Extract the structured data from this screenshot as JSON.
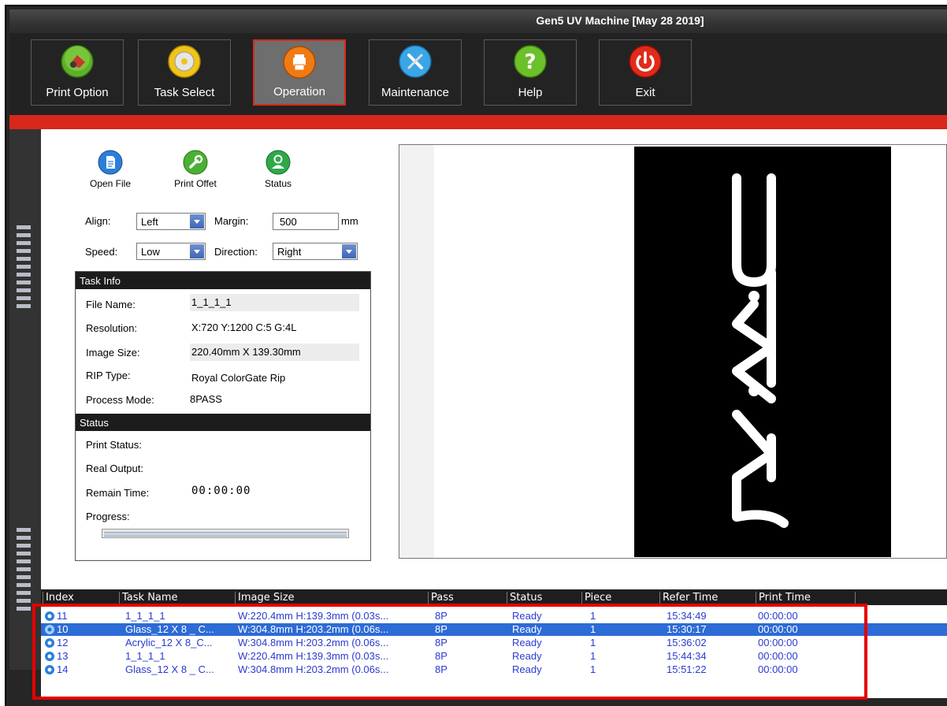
{
  "window": {
    "title": "Gen5 UV Machine [May 28 2019]"
  },
  "toolbar": {
    "buttons": [
      {
        "label": "Print Option",
        "icon": "printer-gear-icon"
      },
      {
        "label": "Task Select",
        "icon": "disc-icon"
      },
      {
        "label": "Operation",
        "icon": "print-icon"
      },
      {
        "label": "Maintenance",
        "icon": "tools-icon"
      },
      {
        "label": "Help",
        "icon": "help-icon"
      },
      {
        "label": "Exit",
        "icon": "power-icon"
      }
    ],
    "active": "Operation"
  },
  "actions": {
    "open_file": "Open File",
    "print_offset": "Print Offet",
    "status": "Status"
  },
  "settings": {
    "align_label": "Align:",
    "align_value": "Left",
    "margin_label": "Margin:",
    "margin_value": "500",
    "margin_unit": "mm",
    "speed_label": "Speed:",
    "speed_value": "Low",
    "direction_label": "Direction:",
    "direction_value": "Right"
  },
  "task_info": {
    "header": "Task Info",
    "file_name_label": "File Name:",
    "file_name": "1_1_1_1",
    "resolution_label": "Resolution:",
    "resolution": "X:720 Y:1200 C:5 G:4L",
    "image_size_label": "Image Size:",
    "image_size": "220.40mm X 139.30mm",
    "rip_type_label": "RIP Type:",
    "rip_type": "Royal ColorGate Rip",
    "process_mode_label": "Process Mode:",
    "process_mode": "8PASS"
  },
  "status": {
    "header": "Status",
    "print_status_label": "Print Status:",
    "real_output_label": "Real Output:",
    "remain_time_label": "Remain Time:",
    "remain_time": "00:00:00",
    "progress_label": "Progress:",
    "progress_fraction": 0.0
  },
  "table": {
    "columns": [
      "Index",
      "Task Name",
      "Image Size",
      "Pass",
      "Status",
      "Piece",
      "Refer Time",
      "Print Time"
    ],
    "rows": [
      {
        "index": "11",
        "task": "1_1_1_1",
        "size": "W:220.4mm H:139.3mm (0.03s...",
        "pass": "8P",
        "status": "Ready",
        "piece": "1",
        "refer": "15:34:49",
        "print": "00:00:00"
      },
      {
        "index": "10",
        "task": "Glass_12 X 8 _ C...",
        "size": "W:304.8mm H:203.2mm (0.06s...",
        "pass": "8P",
        "status": "Ready",
        "piece": "1",
        "refer": "15:30:17",
        "print": "00:00:00"
      },
      {
        "index": "12",
        "task": "Acrylic_12 X 8_C...",
        "size": "W:304.8mm H:203.2mm (0.06s...",
        "pass": "8P",
        "status": "Ready",
        "piece": "1",
        "refer": "15:36:02",
        "print": "00:00:00"
      },
      {
        "index": "13",
        "task": "1_1_1_1",
        "size": "W:220.4mm H:139.3mm (0.03s...",
        "pass": "8P",
        "status": "Ready",
        "piece": "1",
        "refer": "15:44:34",
        "print": "00:00:00"
      },
      {
        "index": "14",
        "task": "Glass_12 X 8 _ C...",
        "size": "W:304.8mm H:203.2mm (0.06s...",
        "pass": "8P",
        "status": "Ready",
        "piece": "1",
        "refer": "15:51:22",
        "print": "00:00:00"
      }
    ],
    "selected_index": "10"
  },
  "colors": {
    "accent_red": "#d8281c",
    "selection_blue": "#2d6bd6",
    "row_text_blue": "#2a3bd0"
  }
}
